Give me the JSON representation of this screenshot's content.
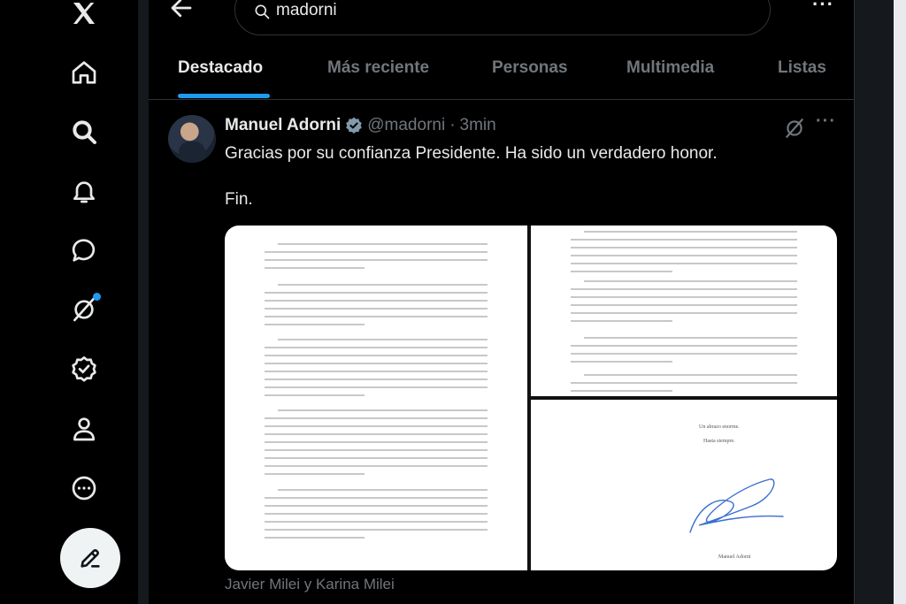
{
  "colors": {
    "accent": "#1d9bf0",
    "background": "#000000",
    "text": "#e7e9ea",
    "muted": "#71767b",
    "border": "#2f3336"
  },
  "nav": {
    "items": [
      {
        "name": "x-logo-icon"
      },
      {
        "name": "home-icon"
      },
      {
        "name": "search-icon"
      },
      {
        "name": "notifications-icon"
      },
      {
        "name": "messages-icon"
      },
      {
        "name": "grok-icon"
      },
      {
        "name": "verified-orgs-icon"
      },
      {
        "name": "profile-icon"
      },
      {
        "name": "more-icon"
      }
    ],
    "compose_icon": "compose-icon"
  },
  "search": {
    "query": "madorni"
  },
  "tabs": [
    {
      "label": "Destacado",
      "active": true
    },
    {
      "label": "Más reciente",
      "active": false
    },
    {
      "label": "Personas",
      "active": false
    },
    {
      "label": "Multimedia",
      "active": false
    },
    {
      "label": "Listas",
      "active": false
    }
  ],
  "tweet": {
    "author": "Manuel Adorni",
    "handle": "@madorni",
    "separator": "·",
    "time": "3min",
    "text": "Gracias por su confianza Presidente. Ha sido un verdadero honor.\n\nFin.",
    "media_caption": "Javier Milei y Karina Milei",
    "letter": {
      "closing": "Un abrazo enorme.",
      "closing_2": "Hasta siempre.",
      "signature_name": "Manuel Adorni"
    }
  }
}
